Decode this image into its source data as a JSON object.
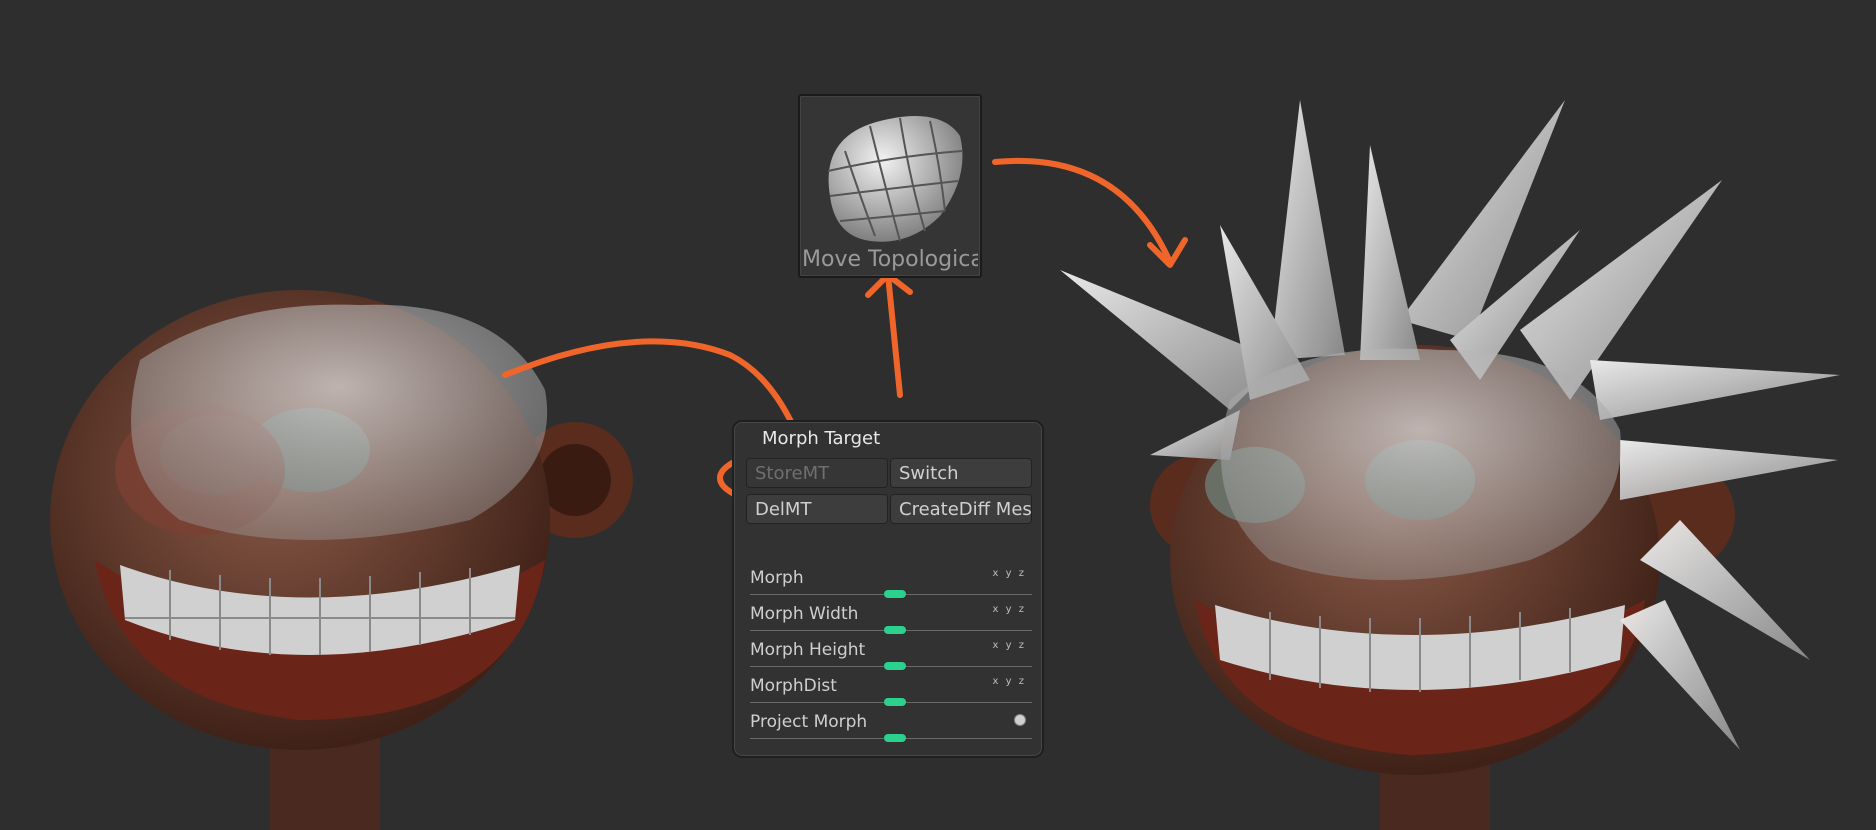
{
  "brush": {
    "label": "Move Topologica",
    "icon": "move-topological-brush-icon"
  },
  "morph_target": {
    "title": "Morph Target",
    "store_label": "StoreMT",
    "switch_label": "Switch",
    "del_label": "DelMT",
    "create_diff_label": "CreateDiff Mesh",
    "sliders": [
      {
        "label": "Morph",
        "axis": "x y z",
        "level": 0.5
      },
      {
        "label": "Morph Width",
        "axis": "x y z",
        "level": 0.5
      },
      {
        "label": "Morph Height",
        "axis": "x y z",
        "level": 0.5
      },
      {
        "label": "MorphDist",
        "axis": "x y z",
        "level": 0.5
      },
      {
        "label": "Project Morph",
        "axis": "",
        "level": 0.5
      }
    ]
  },
  "colors": {
    "background": "#2e2e2e",
    "annotation": "#f0662a",
    "slider_accent": "#2bd18c"
  }
}
